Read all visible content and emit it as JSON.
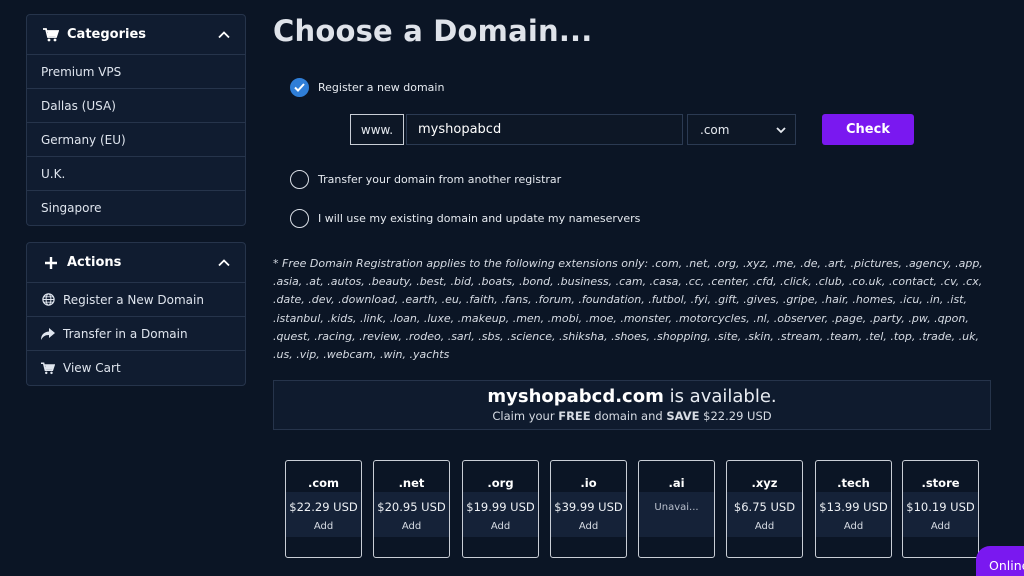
{
  "sidebar": {
    "categories": {
      "title": "Categories",
      "items": [
        "Premium VPS",
        "Dallas (USA)",
        "Germany (EU)",
        "U.K.",
        "Singapore"
      ]
    },
    "actions": {
      "title": "Actions",
      "items": [
        {
          "label": "Register a New Domain",
          "icon": "globe-icon"
        },
        {
          "label": "Transfer in a Domain",
          "icon": "share-arrow-icon"
        },
        {
          "label": "View Cart",
          "icon": "cart-icon"
        }
      ]
    }
  },
  "main": {
    "title": "Choose a Domain...",
    "options": {
      "register": "Register a new domain",
      "transfer": "Transfer your domain from another registrar",
      "existing": "I will use my existing domain and update my nameservers"
    },
    "search": {
      "prefix": "www.",
      "value": "myshopabcd",
      "tld": ".com",
      "check_label": "Check"
    },
    "note": "* Free Domain Registration applies to the following extensions only: .com, .net, .org, .xyz, .me, .de, .art, .pictures, .agency, .app, .asia, .at, .autos, .beauty, .best, .bid, .boats, .bond, .business, .cam, .casa, .cc, .center, .cfd, .click, .club, .co.uk, .contact, .cv, .cx, .date, .dev, .download, .earth, .eu, .faith, .fans, .forum, .foundation, .futbol, .fyi, .gift, .gives, .gripe, .hair, .homes, .icu, .in, .ist, .istanbul, .kids, .link, .loan, .luxe, .makeup, .men, .mobi, .moe, .monster, .motorcycles, .nl, .observer, .page, .party, .pw, .qpon, .quest, .racing, .review, .rodeo, .sarl, .sbs, .science, .shiksha, .shoes, .shopping, .site, .skin, .stream, .team, .tel, .top, .trade, .uk, .us, .vip, .webcam, .win, .yachts",
    "availability": {
      "domain": "myshopabcd.com",
      "status_text": " is available.",
      "claim_prefix": "Claim your ",
      "free": "FREE",
      "claim_middle": " domain and ",
      "save": "SAVE",
      "amount": " $22.29 USD"
    },
    "tlds": [
      {
        "name": ".com",
        "price": "$22.29 USD",
        "action": "Add"
      },
      {
        "name": ".net",
        "price": "$20.95 USD",
        "action": "Add"
      },
      {
        "name": ".org",
        "price": "$19.99 USD",
        "action": "Add"
      },
      {
        "name": ".io",
        "price": "$39.99 USD",
        "action": "Add"
      },
      {
        "name": ".ai",
        "price": "",
        "action": "Unavai..."
      },
      {
        "name": ".xyz",
        "price": "$6.75 USD",
        "action": "Add"
      },
      {
        "name": ".tech",
        "price": "$13.99 USD",
        "action": "Add"
      },
      {
        "name": ".store",
        "price": "$10.19 USD",
        "action": "Add"
      }
    ]
  },
  "chat": {
    "label": "Online"
  },
  "colors": {
    "accent": "#7a18f0",
    "radio_checked": "#2f7ed8",
    "background": "#0b1525"
  }
}
